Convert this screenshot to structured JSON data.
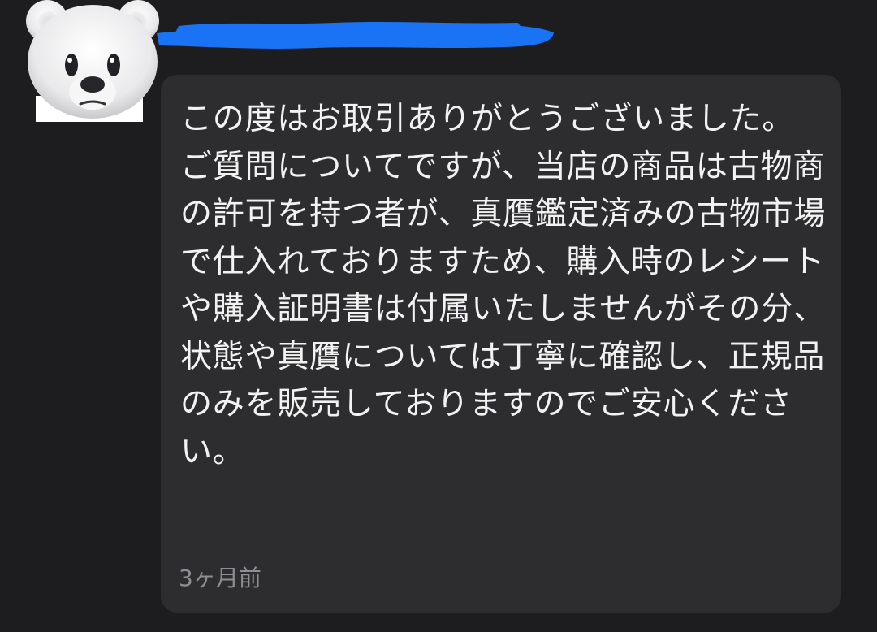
{
  "message": {
    "avatar_icon": "polar-bear-icon",
    "username_redacted": true,
    "redaction_color": "#1a73f5",
    "body": "この度はお取引ありがとうございました。\nご質問についてですが、当店の商品は古物商の許可を持つ者が、真贋鑑定済みの古物市場で仕入れておりますため、購入時のレシートや購入証明書は付属いたしませんがその分、状態や真贋については丁寧に確認し、正規品のみを販売しておりますのでご安心ください。",
    "timestamp": "3ヶ月前"
  },
  "colors": {
    "background": "#1d1d1f",
    "bubble": "#2d2d2f",
    "text": "#f2f2f2",
    "timestamp": "#8e8e93"
  }
}
